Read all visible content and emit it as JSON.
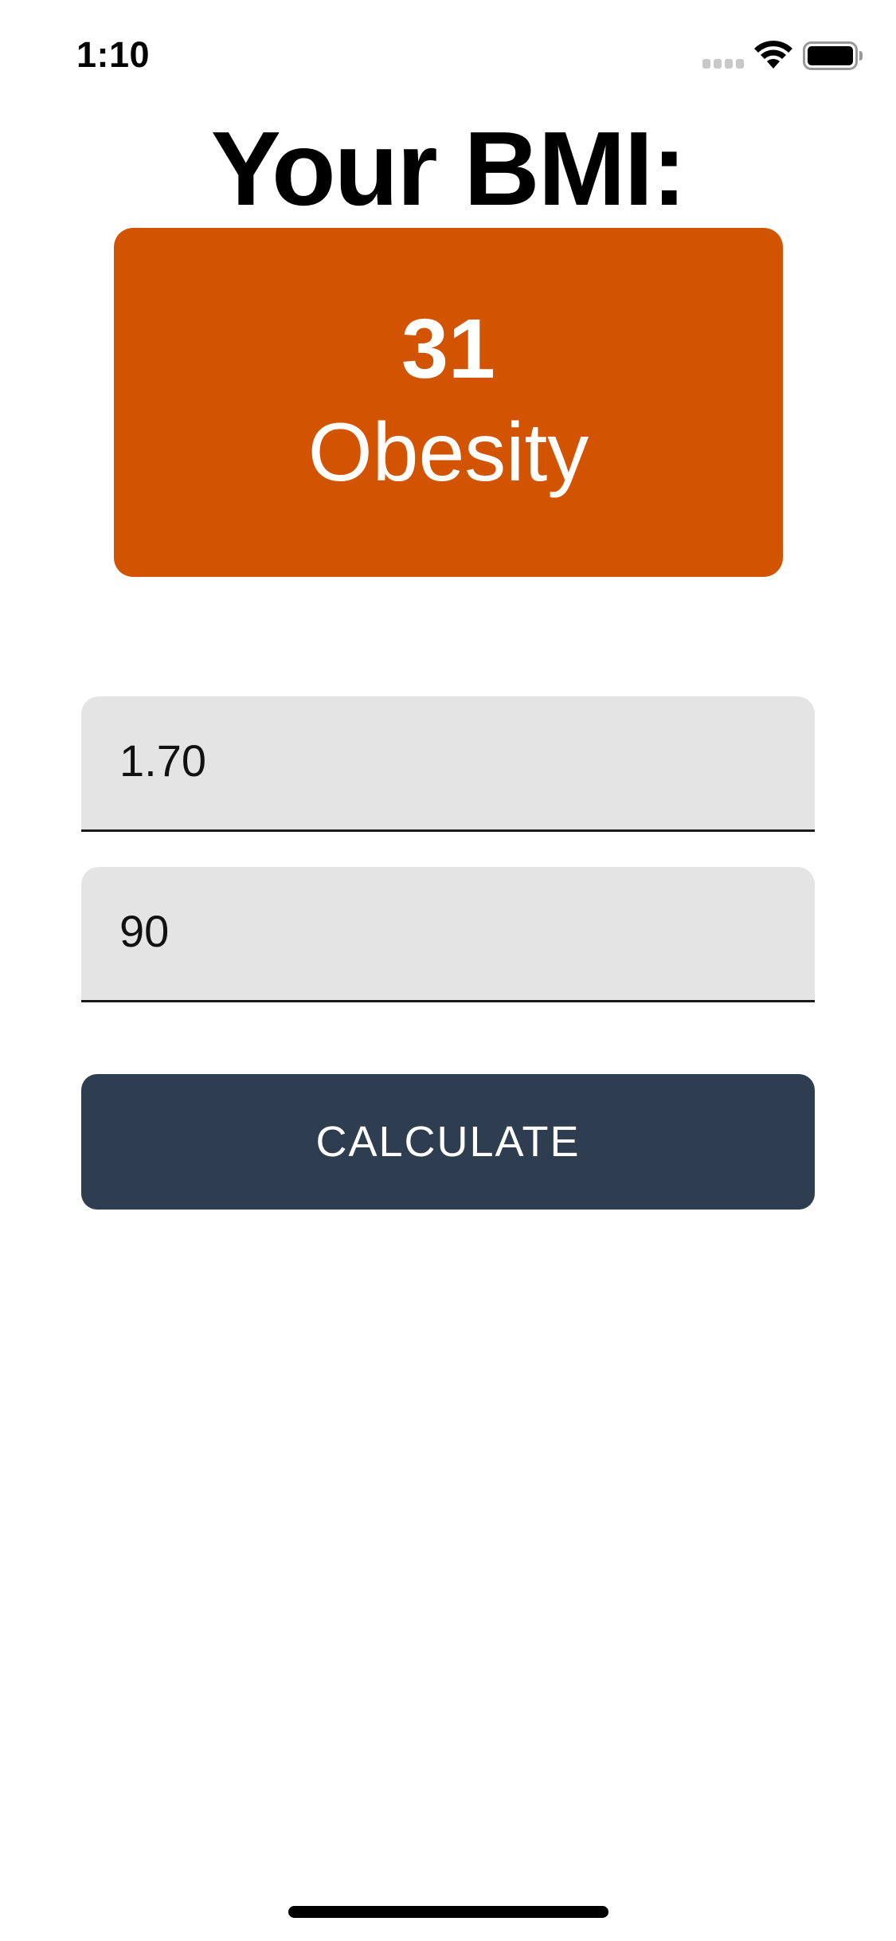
{
  "status_bar": {
    "time": "1:10",
    "icons": [
      "cellular-signal-icon",
      "wifi-icon",
      "battery-icon"
    ]
  },
  "title": "Your BMI:",
  "result": {
    "value": "31",
    "category": "Obesity",
    "color": "#D35400"
  },
  "form": {
    "height_value": "1.70",
    "weight_value": "90"
  },
  "calculate_button": {
    "label": "CALCULATE",
    "color": "#2E3E50"
  }
}
